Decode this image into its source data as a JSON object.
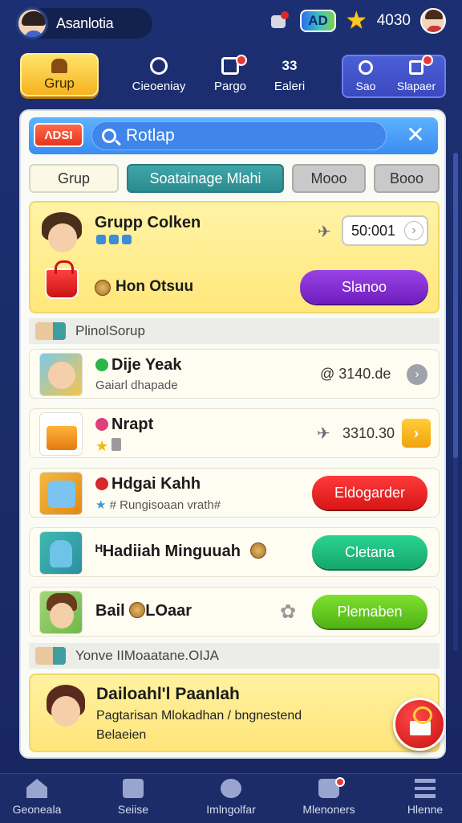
{
  "header": {
    "username": "Asanlotia",
    "ad_label": "AD",
    "coins": "4030"
  },
  "topnav": {
    "items": [
      {
        "label": "Grup"
      },
      {
        "label": "Cieoeniay"
      },
      {
        "label": "Pargo"
      },
      {
        "label": "Ealeri",
        "icon_text": "33"
      },
      {
        "label": "Sao"
      },
      {
        "label": "Slapaer"
      }
    ]
  },
  "search": {
    "brand": "ΛDSI",
    "placeholder": "Rotlap",
    "close": "✕"
  },
  "tabs": [
    "Grup",
    "Soatainage Mlahi",
    "Mooo",
    "Booo"
  ],
  "featured": {
    "title": "Grupp Colken",
    "counter": "50:001",
    "subtitle": "Hon Otsuu",
    "button": "Slanoo"
  },
  "sections": [
    {
      "label": "PlinolSorup"
    },
    {
      "label": "Yonve IIMoaatane.OIJA"
    }
  ],
  "list": [
    {
      "title": "Dije Yeak",
      "subtitle": "Gaiarl dhapade",
      "value": "@ 3140.de",
      "colors": {
        "dot": "#2bb64a"
      }
    },
    {
      "title": "Nrapt",
      "subtitle": "",
      "value": "3310.30",
      "colors": {
        "dot": "#e0407a"
      }
    },
    {
      "title": "Hdgai Kahh",
      "subtitle": "# Rungisoaan vrath#",
      "button": "Eldogarder",
      "colors": {
        "dot": "#d8262a"
      }
    },
    {
      "title": "ᴴHadiiah Minguuah",
      "button": "Cletana"
    },
    {
      "title": "Bail",
      "title_suffix": "LOaar",
      "button": "Plemaben"
    }
  ],
  "promo": {
    "title": "Dailoahl'l Paanlah",
    "line1": "Pagtarisan Mlokadhan / bngnestend",
    "line2": "Belaeien"
  },
  "bottomnav": [
    {
      "label": "Geoneala"
    },
    {
      "label": "Seiise"
    },
    {
      "label": "Imlngolfar"
    },
    {
      "label": "Mlenoners"
    },
    {
      "label": "Hlenne"
    }
  ],
  "colors": {
    "background": "#1c2f72",
    "panel": "#fbfbf6",
    "featured_yellow": "#ffe77a",
    "accent_purple": "#6f1dc0",
    "accent_red": "#d81616",
    "accent_teal": "#15a76c",
    "accent_green": "#4fb214"
  }
}
